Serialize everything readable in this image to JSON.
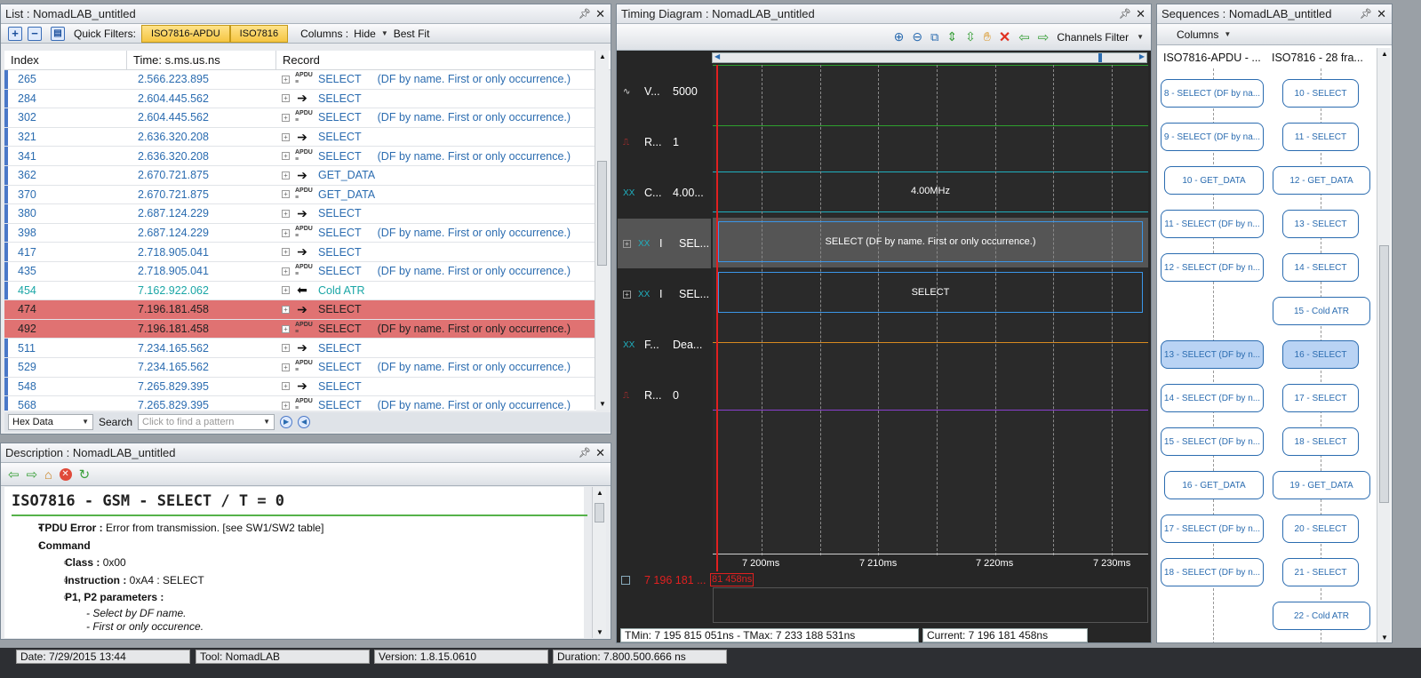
{
  "list": {
    "title": "List : NomadLAB_untitled",
    "quick_filters_label": "Quick Filters:",
    "filter1": "ISO7816-APDU",
    "filter2": "ISO7816",
    "columns_label": "Columns :",
    "hide_label": "Hide",
    "bestfit_label": "Best Fit",
    "headers": [
      "Index",
      "Time: s.ms.us.ns",
      "Record"
    ],
    "rows": [
      {
        "index": "265",
        "time": "2.566.223.895",
        "record": "SELECT",
        "detail": "(DF by name. First or only occurrence.)",
        "kind": "apdu"
      },
      {
        "index": "284",
        "time": "2.604.445.562",
        "record": "SELECT",
        "detail": "",
        "kind": "arrow"
      },
      {
        "index": "302",
        "time": "2.604.445.562",
        "record": "SELECT",
        "detail": "(DF by name. First or only occurrence.)",
        "kind": "apdu"
      },
      {
        "index": "321",
        "time": "2.636.320.208",
        "record": "SELECT",
        "detail": "",
        "kind": "arrow"
      },
      {
        "index": "341",
        "time": "2.636.320.208",
        "record": "SELECT",
        "detail": "(DF by name. First or only occurrence.)",
        "kind": "apdu"
      },
      {
        "index": "362",
        "time": "2.670.721.875",
        "record": "GET_DATA",
        "detail": "",
        "kind": "arrow"
      },
      {
        "index": "370",
        "time": "2.670.721.875",
        "record": "GET_DATA",
        "detail": "",
        "kind": "apdu"
      },
      {
        "index": "380",
        "time": "2.687.124.229",
        "record": "SELECT",
        "detail": "",
        "kind": "arrow"
      },
      {
        "index": "398",
        "time": "2.687.124.229",
        "record": "SELECT",
        "detail": "(DF by name. First or only occurrence.)",
        "kind": "apdu"
      },
      {
        "index": "417",
        "time": "2.718.905.041",
        "record": "SELECT",
        "detail": "",
        "kind": "arrow"
      },
      {
        "index": "435",
        "time": "2.718.905.041",
        "record": "SELECT",
        "detail": "(DF by name. First or only occurrence.)",
        "kind": "apdu"
      },
      {
        "index": "454",
        "time": "7.162.922.062",
        "record": "Cold ATR",
        "detail": "",
        "kind": "atr"
      },
      {
        "index": "474",
        "time": "7.196.181.458",
        "record": "SELECT",
        "detail": "",
        "kind": "err-arrow"
      },
      {
        "index": "492",
        "time": "7.196.181.458",
        "record": "SELECT",
        "detail": "(DF by name. First or only occurrence.)",
        "kind": "err-apdu"
      },
      {
        "index": "511",
        "time": "7.234.165.562",
        "record": "SELECT",
        "detail": "",
        "kind": "arrow"
      },
      {
        "index": "529",
        "time": "7.234.165.562",
        "record": "SELECT",
        "detail": "(DF by name. First or only occurrence.)",
        "kind": "apdu"
      },
      {
        "index": "548",
        "time": "7.265.829.395",
        "record": "SELECT",
        "detail": "",
        "kind": "arrow"
      },
      {
        "index": "568",
        "time": "7.265.829.395",
        "record": "SELECT",
        "detail": "(DF by name. First or only occurrence.)",
        "kind": "apdu"
      }
    ],
    "format_select": "Hex Data",
    "search_label": "Search",
    "search_placeholder": "Click to find a pattern"
  },
  "description": {
    "title": "Description  : NomadLAB_untitled",
    "heading": "ISO7816 - GSM - SELECT / T = 0",
    "tpdu_label": "TPDU Error :",
    "tpdu_value": "Error from transmission. [see SW1/SW2 table]",
    "command_label": "Command",
    "class_label": "Class :",
    "class_value": "0x00",
    "instruction_label": "Instruction :",
    "instruction_value": "0xA4 : SELECT",
    "p1p2_label": "P1, P2 parameters :",
    "p1p2_line1": "- Select by DF name.",
    "p1p2_line2": "- First or only occurence."
  },
  "timing": {
    "title": "Timing Diagram : NomadLAB_untitled",
    "channels_filter": "Channels Filter",
    "channels": [
      {
        "code": "V...",
        "value": "5000",
        "icon": "wave"
      },
      {
        "code": "R...",
        "value": "1",
        "icon": "reset"
      },
      {
        "code": "C...",
        "value": "4.00...",
        "icon": "clock"
      },
      {
        "code": "I",
        "value": "SEL...",
        "icon": "io"
      },
      {
        "code": "I",
        "value": "SEL...",
        "icon": "io"
      },
      {
        "code": "F...",
        "value": "Dea...",
        "icon": "clock"
      },
      {
        "code": "R...",
        "value": "0",
        "icon": "reset"
      }
    ],
    "clock_label": "4.00MHz",
    "io1_label": "SELECT   (DF by name. First or only occurrence.)",
    "io2_label": "SELECT",
    "ticks": [
      "7 200ms",
      "7 210ms",
      "7 220ms",
      "7 230ms"
    ],
    "cursor_time": "7 196 181 ...",
    "cursor_tag": "81 458ns",
    "tmin_tmax": "TMin: 7 195 815 051ns - TMax: 7 233 188 531ns",
    "current": "Current: 7 196 181 458ns"
  },
  "sequences": {
    "title": "Sequences : NomadLAB_untitled",
    "columns_label": "Columns",
    "col1": "ISO7816-APDU - ...",
    "col2": "ISO7816 - 28 fra...",
    "left_boxes": [
      "8 - SELECT    (DF by na...",
      "9 - SELECT    (DF by na...",
      "10 - GET_DATA",
      "11 - SELECT    (DF by n...",
      "12 - SELECT    (DF by n...",
      "",
      "13 - SELECT    (DF by n...",
      "14 - SELECT    (DF by n...",
      "15 - SELECT    (DF by n...",
      "16 - GET_DATA",
      "17 - SELECT    (DF by n...",
      "18 - SELECT    (DF by n...",
      ""
    ],
    "right_boxes": [
      "10 - SELECT",
      "11 - SELECT",
      "12 - GET_DATA",
      "13 - SELECT",
      "14 - SELECT",
      "15 - Cold ATR",
      "16 - SELECT",
      "17 - SELECT",
      "18 - SELECT",
      "19 - GET_DATA",
      "20 - SELECT",
      "21 - SELECT",
      "22 - Cold ATR"
    ]
  },
  "status": {
    "date": "Date: 7/29/2015 13:44",
    "tool": "Tool: NomadLAB",
    "version": "Version: 1.8.15.0610",
    "duration": "Duration: 7.800.500.666 ns"
  },
  "colors": {
    "accent": "#2b6cb0",
    "error_row": "#e07272",
    "atr": "#1aa6a6",
    "cursor": "#e02020"
  }
}
